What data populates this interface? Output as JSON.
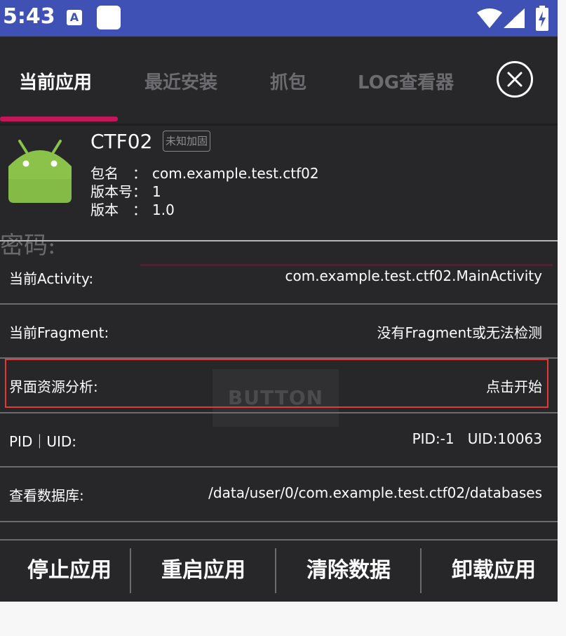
{
  "status_bar": {
    "time": "5:43",
    "notification_letter": "A"
  },
  "tabs": [
    {
      "label": "当前应用"
    },
    {
      "label": "最近安装"
    },
    {
      "label": "抓包"
    },
    {
      "label": "LOG查看器"
    }
  ],
  "app": {
    "name": "CTF02",
    "harden_tag": "未知加固",
    "package_label": "包名",
    "package": "com.example.test.ctf02",
    "version_code_label": "版本号",
    "version_code": "1",
    "version_name_label": "版本",
    "version_name": "1.0"
  },
  "background": {
    "password_hint": "密码:",
    "button_text": "BUTTON"
  },
  "rows": [
    {
      "label": "当前Activity:",
      "value": "com.example.test.ctf02.MainActivity"
    },
    {
      "label": "当前Fragment:",
      "value": "没有Fragment或无法检测"
    },
    {
      "label": "界面资源分析:",
      "value": "点击开始"
    },
    {
      "label": "PID｜UID:",
      "value": "PID:-1   UID:10063"
    },
    {
      "label": "查看数据库:",
      "value": "/data/user/0/com.example.test.ctf02/databases"
    }
  ],
  "actions": [
    {
      "label": "停止应用"
    },
    {
      "label": "重启应用"
    },
    {
      "label": "清除数据"
    },
    {
      "label": "卸载应用"
    }
  ],
  "colors": {
    "status_bar": "#3f51b5",
    "panel": "#27272a",
    "tab_indicator": "#c2185b",
    "highlight_border": "#e53935",
    "android_green": "#8bc34a"
  }
}
